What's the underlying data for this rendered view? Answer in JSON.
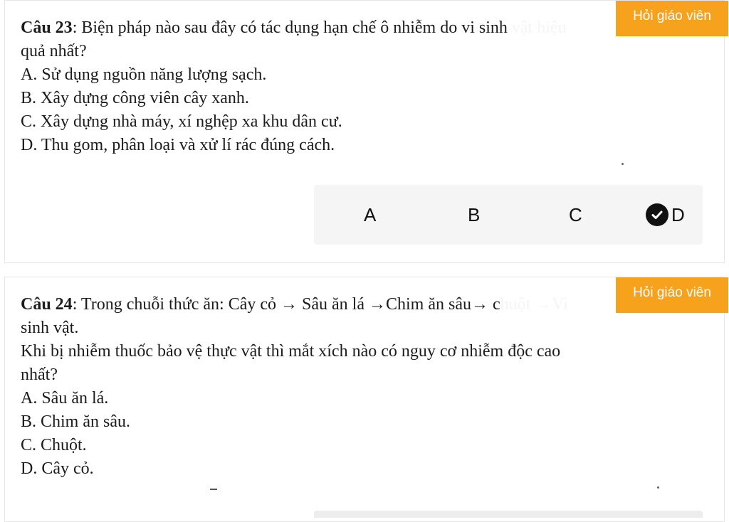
{
  "ask_teacher_label": "Hỏi giáo viên",
  "q23": {
    "label": "Câu 23",
    "line1": ": Biện pháp nào sau đây có tác dụng hạn chế ô nhiễm do vi sinh ",
    "hidden_tail": "vật hiệu",
    "line2": "quả nhất?",
    "options": [
      "A. Sử dụng nguồn năng lượng sạch.",
      "B. Xây dựng công viên cây xanh.",
      "C. Xây dựng nhà máy, xí nghệp xa khu dân cư.",
      "D. Thu gom, phân loại và xử lí rác đúng cách."
    ],
    "answers": [
      "A",
      "B",
      "C",
      "D"
    ],
    "selected": "D"
  },
  "q24": {
    "label": "Câu 24",
    "line1": ": Trong chuỗi thức ăn: Cây cỏ → Sâu ăn lá →Chim ăn sâu→ c",
    "hidden_tail": "huột →Vi",
    "line2": "sinh vật.",
    "line3": "Khi bị nhiễm thuốc bảo vệ thực vật thì mắt xích nào có nguy cơ nhiễm độc cao",
    "line4": "nhất?",
    "options": [
      "A. Sâu ăn lá.",
      "B. Chim ăn sâu.",
      "C. Chuột.",
      "D. Cây cỏ."
    ]
  }
}
